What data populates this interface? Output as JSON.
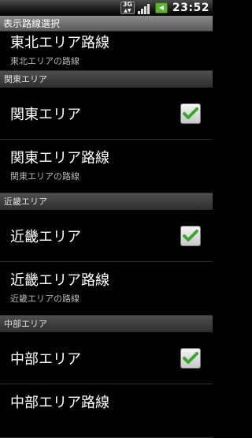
{
  "status_bar": {
    "network": "3G",
    "time": "23:52"
  },
  "title": "表示路線選択",
  "partial_top_row": {
    "title": "東北エリア路線",
    "subtitle": "東北エリアの路線"
  },
  "sections": [
    {
      "header": "関東エリア",
      "area_title": "関東エリア",
      "area_checked": true,
      "routes_title": "関東エリア路線",
      "routes_subtitle": "関東エリアの路線"
    },
    {
      "header": "近畿エリア",
      "area_title": "近畿エリア",
      "area_checked": true,
      "routes_title": "近畿エリア路線",
      "routes_subtitle": "近畿エリアの路線"
    },
    {
      "header": "中部エリア",
      "area_title": "中部エリア",
      "area_checked": true,
      "routes_title": "中部エリア路線"
    }
  ],
  "colors": {
    "check_green": "#3aa82c",
    "section_header": "#3a3a3a",
    "title_bar": "#707070"
  },
  "icons": [
    "network-3g-icon",
    "signal-strength-icon",
    "battery-charging-icon",
    "checkmark-icon"
  ]
}
